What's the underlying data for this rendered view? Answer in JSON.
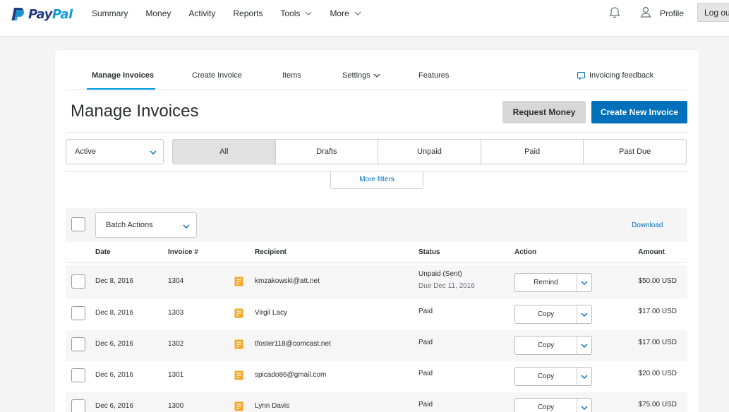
{
  "brand": {
    "pay": "Pay",
    "pal": "Pal",
    "primary_color": "#253b80",
    "accent_color": "#179bd7"
  },
  "topnav": {
    "items": [
      {
        "label": "Summary"
      },
      {
        "label": "Money"
      },
      {
        "label": "Activity"
      },
      {
        "label": "Reports"
      },
      {
        "label": "Tools",
        "dropdown": true
      },
      {
        "label": "More",
        "dropdown": true
      }
    ],
    "profile_label": "Profile",
    "logout_label": "Log out"
  },
  "subnav": {
    "tabs": [
      {
        "label": "Manage Invoices",
        "active": true
      },
      {
        "label": "Create Invoice"
      },
      {
        "label": "Items"
      },
      {
        "label": "Settings",
        "dropdown": true
      },
      {
        "label": "Features"
      }
    ],
    "feedback_label": "Invoicing feedback"
  },
  "page": {
    "title": "Manage Invoices",
    "request_money_label": "Request Money",
    "create_invoice_label": "Create New Invoice",
    "create_button_color": "#0070ba"
  },
  "filters": {
    "active_select_value": "Active",
    "tabs": [
      "All",
      "Drafts",
      "Unpaid",
      "Paid",
      "Past Due"
    ],
    "selected_tab": "All",
    "more_filters_label": "More filters"
  },
  "batch": {
    "select_label": "Batch Actions",
    "download_label": "Download"
  },
  "table": {
    "columns": [
      "Date",
      "Invoice #",
      "Recipient",
      "Status",
      "Action",
      "Amount"
    ],
    "rows": [
      {
        "date": "Dec 8, 2016",
        "invoice": "1304",
        "recipient": "kmzakowski@att.net",
        "status": "Unpaid (Sent)",
        "status_sub": "Due Dec 11, 2016",
        "action": "Remind",
        "amount": "$50.00 USD"
      },
      {
        "date": "Dec 8, 2016",
        "invoice": "1303",
        "recipient": "Virgil Lacy",
        "status": "Paid",
        "status_sub": "",
        "action": "Copy",
        "amount": "$17.00 USD"
      },
      {
        "date": "Dec 6, 2016",
        "invoice": "1302",
        "recipient": "tfoster118@comcast.net",
        "status": "Paid",
        "status_sub": "",
        "action": "Copy",
        "amount": "$17.00 USD"
      },
      {
        "date": "Dec 6, 2016",
        "invoice": "1301",
        "recipient": "spicado86@gmail.com",
        "status": "Paid",
        "status_sub": "",
        "action": "Copy",
        "amount": "$20.00 USD"
      },
      {
        "date": "Dec 6, 2016",
        "invoice": "1300",
        "recipient": "Lynn Davis",
        "status": "Paid",
        "status_sub": "",
        "action": "Copy",
        "amount": "$75.00 USD"
      }
    ]
  },
  "colors": {
    "link": "#0070ba",
    "invoice_icon": "#f5a623"
  }
}
